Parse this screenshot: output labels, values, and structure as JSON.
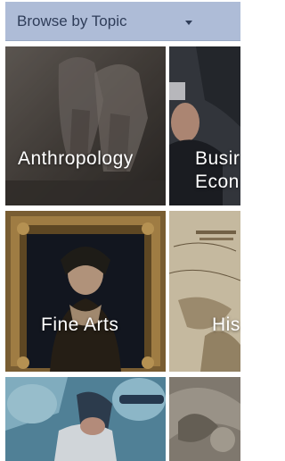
{
  "dropdown": {
    "label": "Browse by Topic",
    "icon": "caret-down-icon"
  },
  "tiles": [
    {
      "label": "Anthropology"
    },
    {
      "label_line1": "Busir",
      "label_line2": "Econ"
    },
    {
      "label": "Fine Arts"
    },
    {
      "label": "His"
    },
    {
      "label": ""
    },
    {
      "label": ""
    }
  ],
  "colors": {
    "dropdown_bg": "#aebcd7",
    "dropdown_text": "#2f3d59",
    "tile_label": "#ffffff"
  }
}
